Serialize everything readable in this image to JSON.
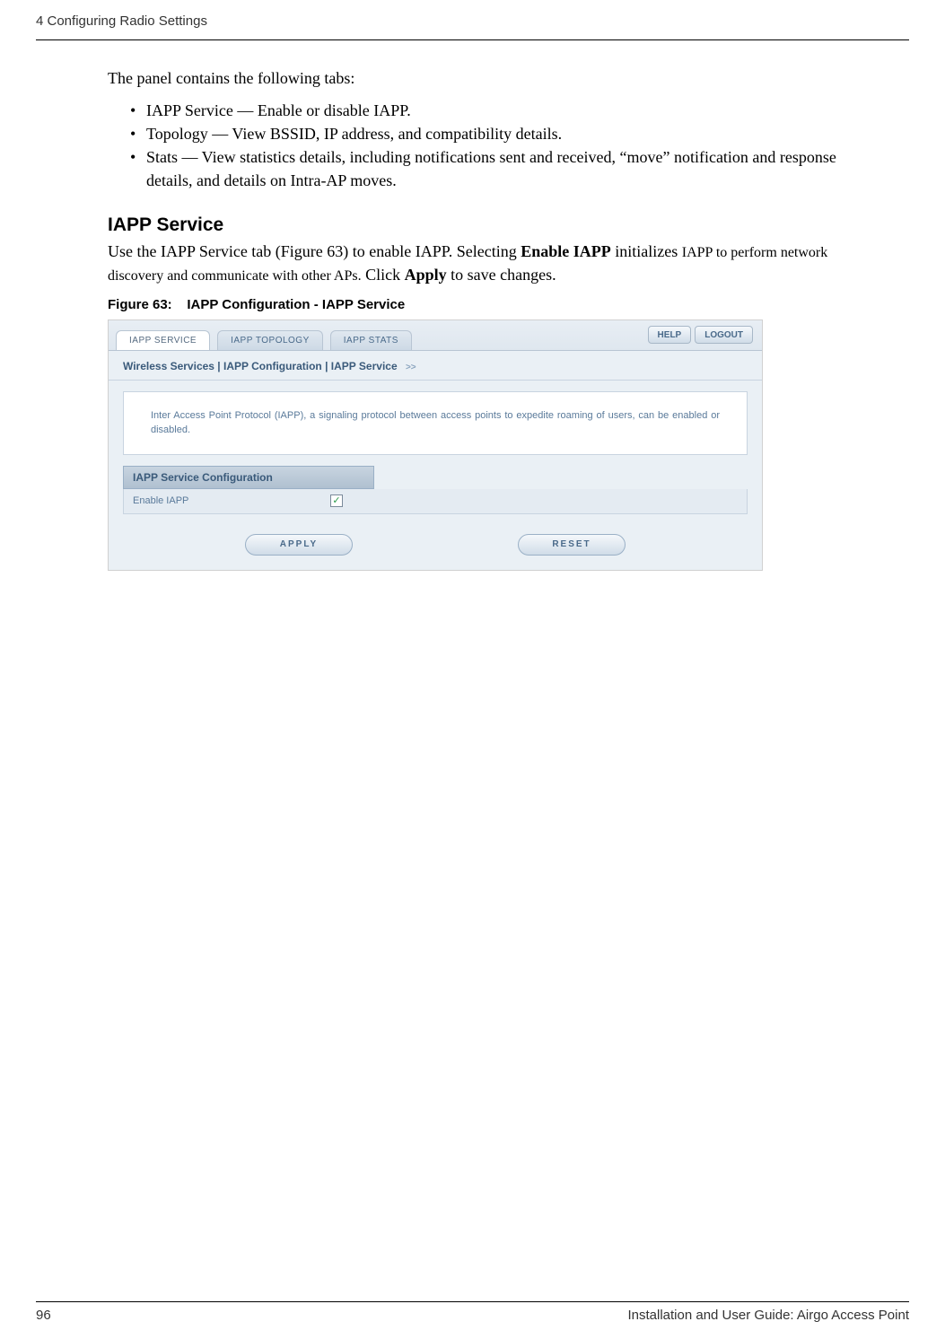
{
  "header": {
    "chapter": "4  Configuring Radio Settings"
  },
  "intro": "The panel contains the following tabs:",
  "bullets": [
    "IAPP Service — Enable or disable IAPP.",
    "Topology — View BSSID, IP address, and compatibility details.",
    "Stats — View statistics details, including notifications sent and received, “move” notification and response details, and details on Intra-AP moves."
  ],
  "section": {
    "heading": "IAPP Service",
    "body_pre": "Use the IAPP Service tab (Figure 63) to enable IAPP. Selecting ",
    "enable_bold": "Enable IAPP",
    "body_mid1": " initializes ",
    "sc1": "IAPP to perform network discovery and communicate with other APs.",
    "body_mid2": " Click ",
    "apply_bold": "Apply",
    "body_end": " to save changes."
  },
  "figure": {
    "caption_label": "Figure 63:",
    "caption_title": "IAPP Configuration - IAPP Service"
  },
  "screenshot": {
    "tabs": {
      "service": "IAPP SERVICE",
      "topology": "IAPP TOPOLOGY",
      "stats": "IAPP STATS"
    },
    "buttons": {
      "help": "HELP",
      "logout": "LOGOUT"
    },
    "breadcrumb": "Wireless Services | IAPP Configuration | IAPP Service",
    "description": "Inter Access Point Protocol (IAPP), a signaling protocol between access points to expedite roaming of users, can be enabled or disabled.",
    "config_header": "IAPP Service Configuration",
    "config_label": "Enable IAPP",
    "checkmark": "✓",
    "apply": "APPLY",
    "reset": "RESET"
  },
  "footer": {
    "page_number": "96",
    "doc_title": "Installation and User Guide: Airgo Access Point"
  }
}
